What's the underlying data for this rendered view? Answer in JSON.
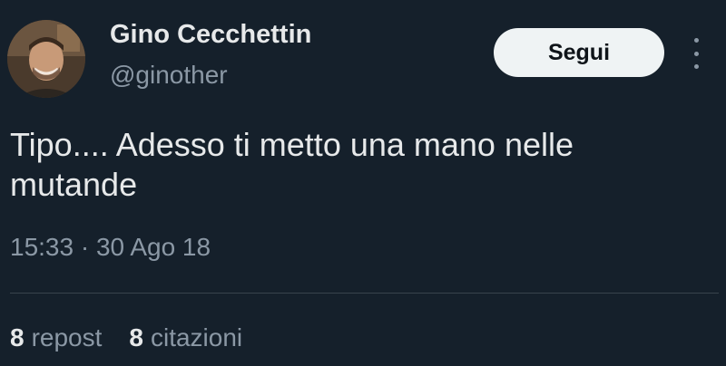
{
  "author": {
    "name": "Gino Cecchettin",
    "handle": "@ginother"
  },
  "follow_button": {
    "label": "Segui"
  },
  "more_icon": "more-vertical-icon",
  "tweet": {
    "text": "Tipo.... Adesso ti metto una mano nelle mutande",
    "timestamp": "15:33 · 30 Ago 18"
  },
  "stats": {
    "reposts": {
      "count": "8",
      "label": "repost"
    },
    "quotes": {
      "count": "8",
      "label": "citazioni"
    }
  },
  "colors": {
    "background": "#15202b",
    "primary_text": "#e7e9ea",
    "secondary_text": "#8b98a5",
    "button_bg": "#eff3f4",
    "divider": "#38444d"
  }
}
